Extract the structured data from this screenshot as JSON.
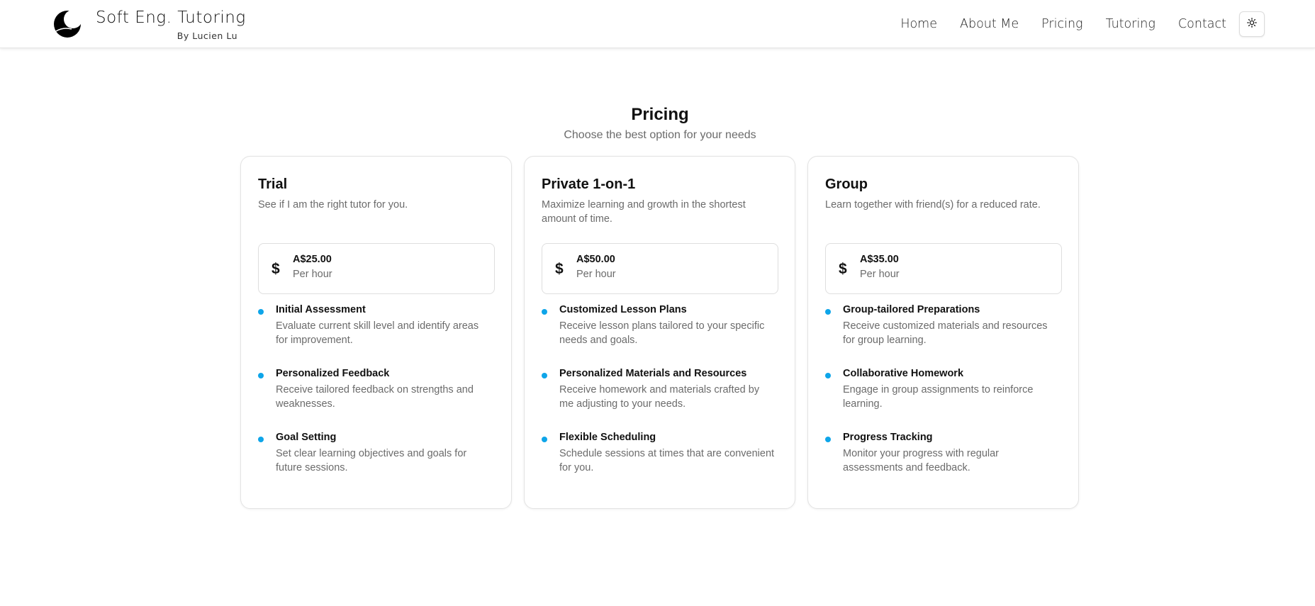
{
  "brand": {
    "title": "Soft Eng. Tutoring",
    "subtitle": "By Lucien Lu",
    "logo_icon": "crescent-moon-logo"
  },
  "nav": {
    "items": [
      "Home",
      "About Me",
      "Pricing",
      "Tutoring",
      "Contact"
    ],
    "theme_toggle_icon": "sun-icon"
  },
  "section": {
    "title": "Pricing",
    "subtitle": "Choose the best option for your needs"
  },
  "colors": {
    "accent": "#0ea5e9",
    "text": "#111111",
    "muted": "#6b6b6b",
    "border": "#e3e3e3"
  },
  "plans": [
    {
      "name": "Trial",
      "description": "See if I am the right tutor for you.",
      "price": "A$25.00",
      "unit": "Per hour",
      "price_icon": "dollar-icon",
      "features": [
        {
          "title": "Initial Assessment",
          "desc": "Evaluate current skill level and identify areas for improvement."
        },
        {
          "title": "Personalized Feedback",
          "desc": "Receive tailored feedback on strengths and weaknesses."
        },
        {
          "title": "Goal Setting",
          "desc": "Set clear learning objectives and goals for future sessions."
        }
      ]
    },
    {
      "name": "Private 1-on-1",
      "description": "Maximize learning and growth in the shortest amount of time.",
      "price": "A$50.00",
      "unit": "Per hour",
      "price_icon": "dollar-icon",
      "features": [
        {
          "title": "Customized Lesson Plans",
          "desc": "Receive lesson plans tailored to your specific needs and goals."
        },
        {
          "title": "Personalized Materials and Resources",
          "desc": "Receive homework and materials crafted by me adjusting to your needs."
        },
        {
          "title": "Flexible Scheduling",
          "desc": "Schedule sessions at times that are convenient for you."
        }
      ]
    },
    {
      "name": "Group",
      "description": "Learn together with friend(s) for a reduced rate.",
      "price": "A$35.00",
      "unit": "Per hour",
      "price_icon": "dollar-icon",
      "features": [
        {
          "title": "Group-tailored Preparations",
          "desc": "Receive customized materials and resources for group learning."
        },
        {
          "title": "Collaborative Homework",
          "desc": "Engage in group assignments to reinforce learning."
        },
        {
          "title": "Progress Tracking",
          "desc": "Monitor your progress with regular assessments and feedback."
        }
      ]
    }
  ]
}
